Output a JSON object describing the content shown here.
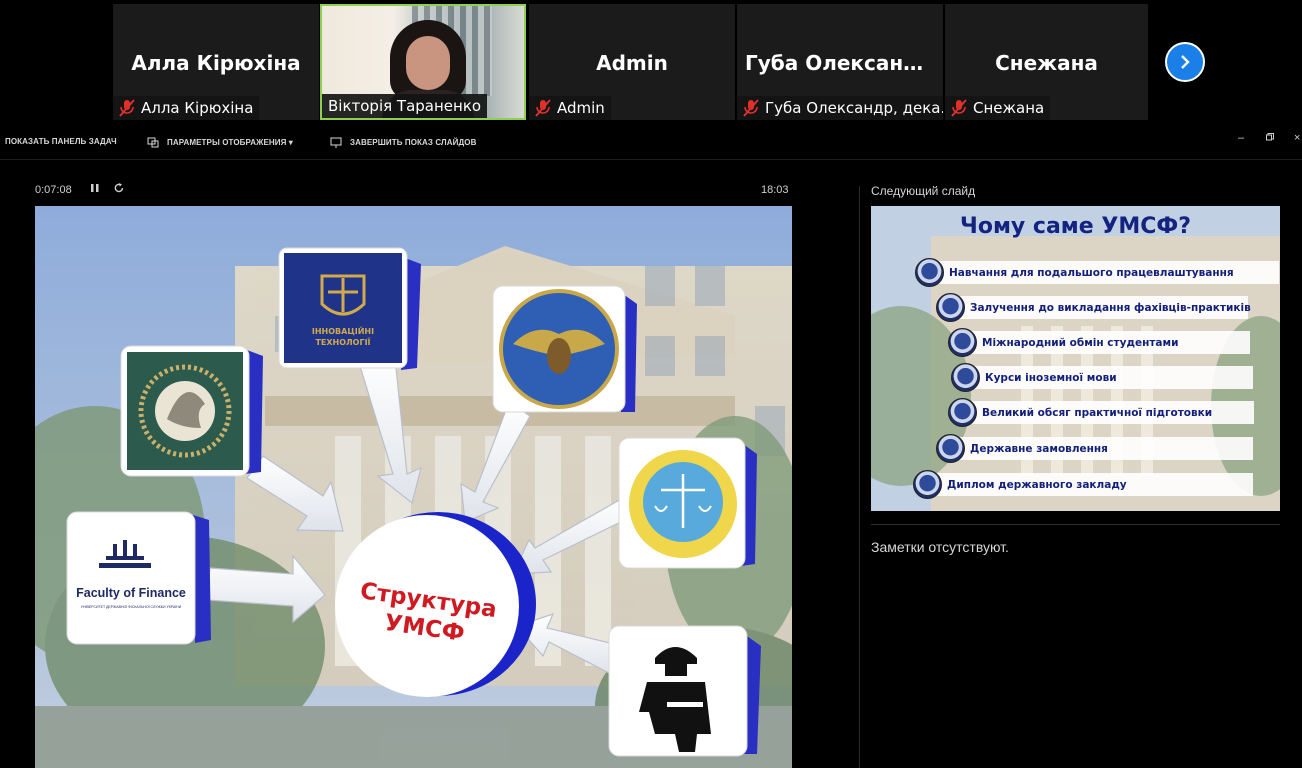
{
  "participants": [
    {
      "big_name": "Алла Кірюхіна",
      "tag": "Алла Кірюхіна",
      "muted": true
    },
    {
      "big_name": "",
      "tag": "Вікторія Тараненко",
      "muted": false,
      "video": true
    },
    {
      "big_name": "Admin",
      "tag": "Admin",
      "muted": true
    },
    {
      "big_name": "Губа Олександ...",
      "tag": "Губа Олександр, дека...",
      "muted": true
    },
    {
      "big_name": "Снежана",
      "tag": "Снежана",
      "muted": true
    }
  ],
  "toolbar": {
    "show_taskbar": "ПОКАЗАТЬ ПАНЕЛЬ ЗАДАЧ",
    "display_settings": "ПАРАМЕТРЫ ОТОБРАЖЕНИЯ ▾",
    "end_show": "ЗАВЕРШИТЬ ПОКАЗ СЛАЙДОВ"
  },
  "presenter": {
    "elapsed": "0:07:08",
    "clock": "18:03",
    "next_slide_label": "Следующий слайд",
    "notes": "Заметки отсутствуют."
  },
  "slide": {
    "center_text": [
      "Структура",
      "УМСФ"
    ],
    "finance_logo": "Faculty of Finance",
    "finance_sub": "УНІВЕРСИТЕТ ДЕРЖАВНОЇ ФІСКАЛЬНОЇ СЛУЖБИ УКРАЇНИ",
    "innov_logo": [
      "ІННОВАЦІЙНІ",
      "ТЕХНОЛОГІЇ"
    ]
  },
  "next_slide": {
    "title": "Чому саме УМСФ?",
    "items": [
      "Навчання для подальшого працевлаштування",
      "Залучення до викладання фахівців-практиків",
      "Міжнародний обмін студентами",
      "Курси іноземної мови",
      "Великий обсяг практичної підготовки",
      "Державне замовлення",
      "Диплом державного закладу"
    ]
  },
  "colors": {
    "accent": "#1a7fe6",
    "active_speaker": "#8fd14f",
    "slide_title": "#13237f",
    "center_text": "#d01a22"
  }
}
